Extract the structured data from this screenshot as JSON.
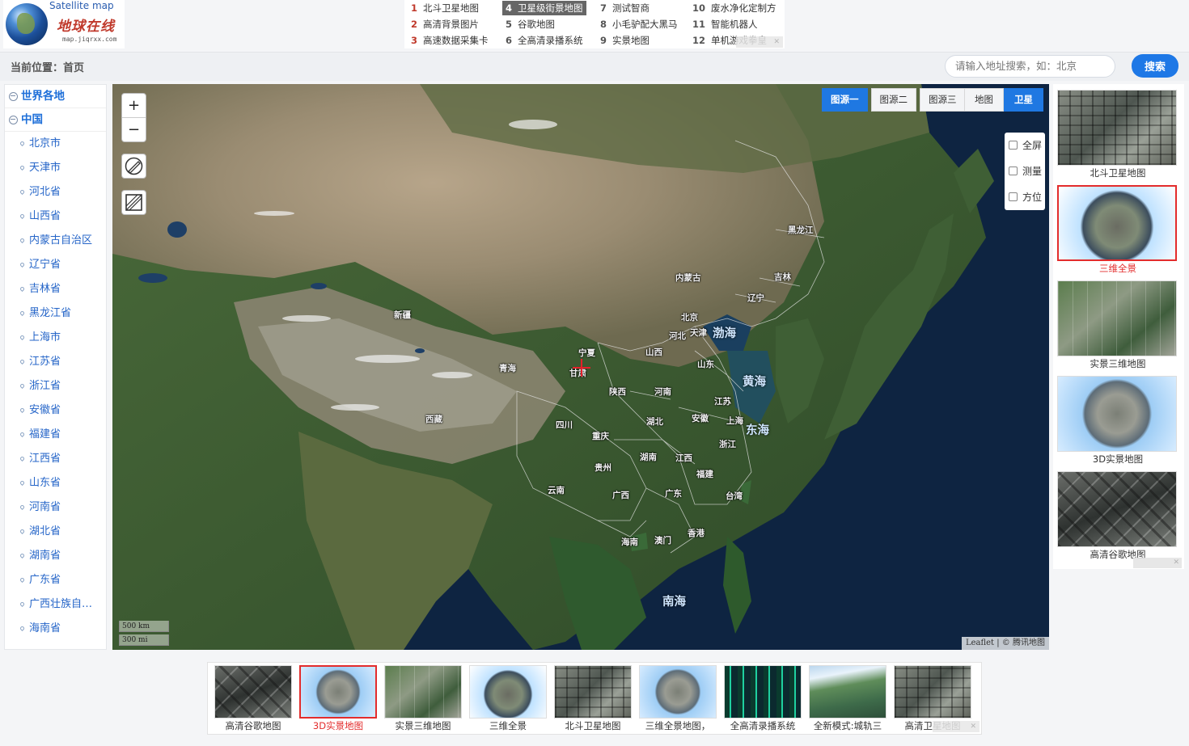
{
  "logo": {
    "en": "Satellite map",
    "cn": "地球在线",
    "url": "map.jiqrxx.com"
  },
  "ad_links": [
    {
      "num": "1",
      "label": "北斗卫星地图"
    },
    {
      "num": "2",
      "label": "高清背景图片"
    },
    {
      "num": "3",
      "label": "高速数据采集卡"
    },
    {
      "num": "4",
      "label": "卫星级街景地图"
    },
    {
      "num": "5",
      "label": "谷歌地图"
    },
    {
      "num": "6",
      "label": "全高清录播系统"
    },
    {
      "num": "7",
      "label": "测试智商"
    },
    {
      "num": "8",
      "label": "小毛驴配大黑马"
    },
    {
      "num": "9",
      "label": "实景地图"
    },
    {
      "num": "10",
      "label": "废水净化定制方"
    },
    {
      "num": "11",
      "label": "智能机器人"
    },
    {
      "num": "12",
      "label": "单机游戏拳皇"
    }
  ],
  "breadcrumb": "当前位置：首页",
  "search": {
    "placeholder": "请输入地址搜索，如：北京",
    "button": "搜索"
  },
  "sidebar": {
    "sections": [
      "世界各地",
      "中国"
    ],
    "items": [
      "北京市",
      "天津市",
      "河北省",
      "山西省",
      "内蒙古自治区",
      "辽宁省",
      "吉林省",
      "黑龙江省",
      "上海市",
      "江苏省",
      "浙江省",
      "安徽省",
      "福建省",
      "江西省",
      "山东省",
      "河南省",
      "湖北省",
      "湖南省",
      "广东省",
      "广西壮族自…",
      "海南省"
    ]
  },
  "map": {
    "zoom_in": "+",
    "zoom_out": "−",
    "sources": [
      "图源一",
      "图源二",
      "图源三"
    ],
    "views": [
      "地图",
      "卫星"
    ],
    "options": [
      "全屏",
      "测量",
      "方位"
    ],
    "scale": [
      "500 km",
      "300 mi"
    ],
    "attribution": "Leaflet | © 腾讯地图",
    "labels": [
      "黑龙江",
      "吉林",
      "辽宁",
      "内蒙古",
      "北京",
      "天津",
      "河北",
      "山西",
      "山东",
      "宁夏",
      "甘肃",
      "青海",
      "新疆",
      "西藏",
      "陕西",
      "河南",
      "江苏",
      "安徽",
      "上海",
      "湖北",
      "四川",
      "重庆",
      "湖南",
      "江西",
      "浙江",
      "贵州",
      "福建",
      "云南",
      "广西",
      "广东",
      "台湾",
      "海南",
      "澳门",
      "香港"
    ],
    "seas": [
      "渤海",
      "黄海",
      "东海",
      "南海"
    ]
  },
  "right_thumbs": [
    "北斗卫星地图",
    "三维全景",
    "实景三维地图",
    "3D实景地图",
    "高清谷歌地图"
  ],
  "bottom_thumbs": [
    "高清谷歌地图",
    "3D实景地图",
    "实景三维地图",
    "三维全景",
    "北斗卫星地图",
    "三维全景地图，",
    "全高清录播系统",
    "全新模式:城轨三",
    "高清卫星地图"
  ],
  "colors": {
    "accent": "#1e78e6",
    "link": "#2565c8",
    "active_border": "#e32c2c",
    "ad_number": "#c0392b"
  }
}
